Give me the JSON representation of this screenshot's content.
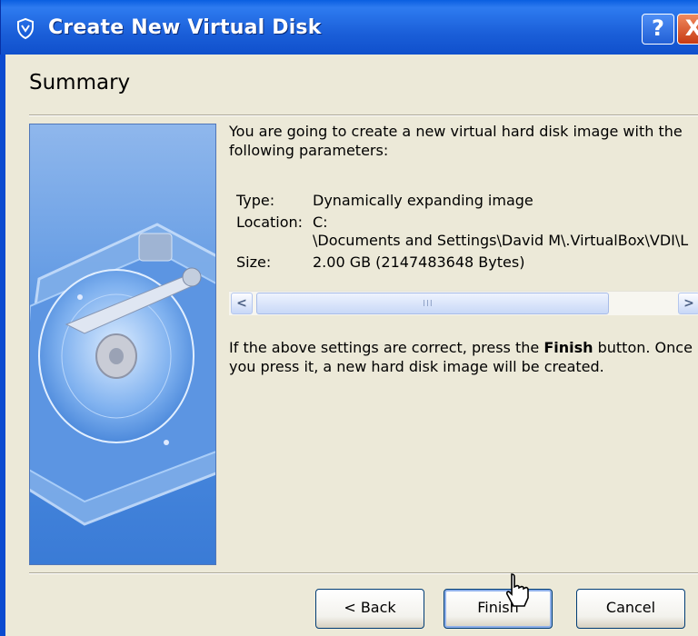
{
  "window": {
    "title": "Create New Virtual Disk",
    "help_label": "?",
    "close_label": "X"
  },
  "page": {
    "title": "Summary"
  },
  "summary": {
    "intro": "You are going to create a new virtual hard disk image with the following parameters:",
    "params": [
      {
        "key": "Type:",
        "value": "Dynamically expanding image"
      },
      {
        "key": "Location:",
        "value": "C:"
      },
      {
        "key": "",
        "value": "\\Documents and Settings\\David M\\.VirtualBox\\VDI\\L"
      },
      {
        "key": "Size:",
        "value": "2.00 GB (2147483648 Bytes)"
      }
    ],
    "note": "If the above settings are correct, press the Finish button. Once you press it, a new hard disk image will be created.",
    "note_parts": {
      "before": "If the above settings are correct, press the ",
      "bold": "Finish",
      "after": " button. Once you press it, a new hard disk image will be created."
    }
  },
  "scrollbar": {
    "left_arrow": "<",
    "right_arrow": ">",
    "grip": "III",
    "position": 0
  },
  "buttons": {
    "back": "< Back",
    "finish": "Finish",
    "cancel": "Cancel"
  },
  "colors": {
    "titlebar": "#0b49c6",
    "dialog_bg": "#ece9d8",
    "button_border": "#003c74",
    "close_red": "#c73a12"
  },
  "icons": {
    "app": "virtualbox-icon",
    "side_image": "hard-disk-illustration"
  }
}
